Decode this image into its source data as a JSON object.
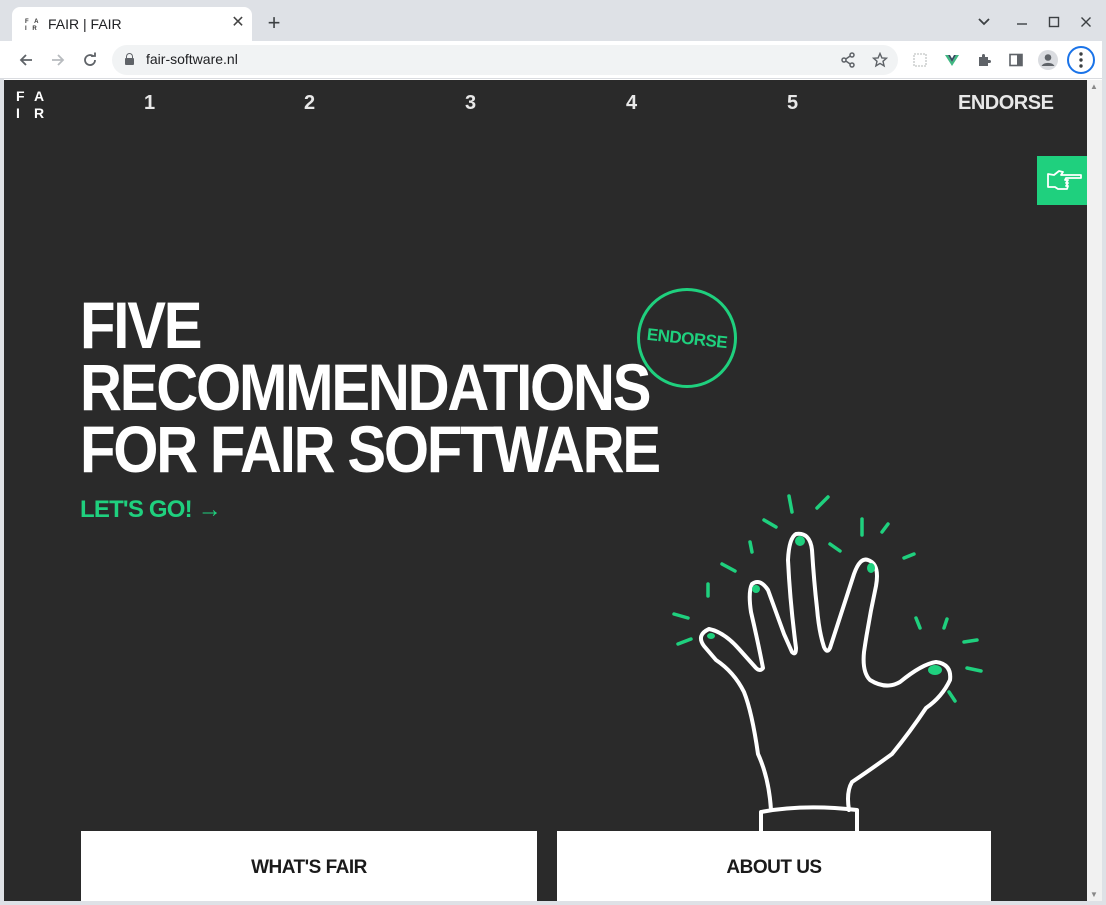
{
  "browser": {
    "tab_title": "FAIR | FAIR",
    "tab_close": "✕",
    "new_tab": "+",
    "url": "fair-software.nl",
    "window_controls": {
      "dropdown": "⌄",
      "minimize": "—",
      "maximize": "☐",
      "close": "✕"
    }
  },
  "page": {
    "logo": {
      "letters": [
        "F",
        "A",
        "I",
        "R"
      ]
    },
    "nav": {
      "items": [
        "1",
        "2",
        "3",
        "4",
        "5"
      ],
      "endorse": "ENDORSE"
    },
    "hero": {
      "title_lines": [
        "FIVE",
        "RECOMMENDATIONS",
        "FOR FAIR SOFTWARE"
      ],
      "cta": "LET'S GO! →",
      "badge": "ENDORSE"
    },
    "cards": [
      {
        "label": "WHAT'S FAIR"
      },
      {
        "label": "ABOUT US"
      }
    ]
  },
  "colors": {
    "background": "#2a2a2a",
    "accent": "#1fd07e",
    "text": "#ffffff"
  },
  "icons": [
    "lock-icon",
    "share-icon",
    "star-icon",
    "extension-icon",
    "puzzle-icon",
    "side-panel-icon",
    "profile-icon",
    "kebab-menu-icon",
    "pointing-hand-icon",
    "hand-illustration"
  ]
}
